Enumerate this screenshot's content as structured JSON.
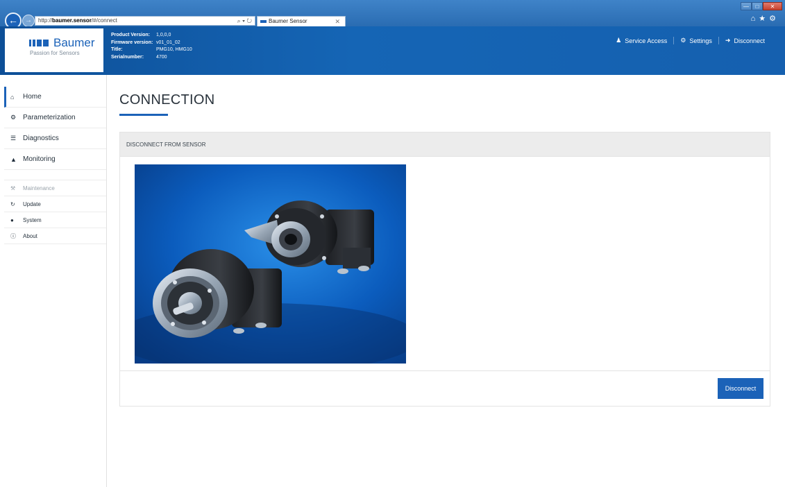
{
  "browser": {
    "url_prefix": "http://",
    "url_host": "baumer.sensor",
    "url_path": "/#/connect",
    "address_tools": "⌕ ▾ ↻",
    "tab_title": "Baumer Sensor",
    "tab_close": "✕",
    "window_min": "—",
    "window_max": "□",
    "window_close": "✕",
    "icons": [
      "home-icon",
      "star-icon",
      "gear-icon"
    ]
  },
  "header": {
    "brand": "Baumer",
    "tagline": "Passion for Sensors",
    "info": [
      {
        "key": "Product Version:",
        "value": "1,0,0,0"
      },
      {
        "key": "Firmware version:",
        "value": "v01_01_02"
      },
      {
        "key": "Title:",
        "value": "PMG10, HMG10"
      },
      {
        "key": "Serialnumber:",
        "value": "4700"
      }
    ],
    "menu": [
      {
        "label": "Service Access",
        "icon": "user-icon"
      },
      {
        "label": "Settings",
        "icon": "gear-icon"
      },
      {
        "label": "Disconnect",
        "icon": "sign-out-icon"
      }
    ]
  },
  "sidebar": {
    "items": [
      {
        "label": "Home",
        "icon": "home-icon",
        "active": true
      },
      {
        "label": "Parameterization",
        "icon": "cogs-icon"
      },
      {
        "label": "Diagnostics",
        "icon": "list-icon"
      },
      {
        "label": "Monitoring",
        "icon": "area-chart-icon"
      }
    ],
    "small_items": [
      {
        "label": "Maintenance",
        "icon": "wrench-icon",
        "muted": true
      },
      {
        "label": "Update",
        "icon": "refresh-icon"
      },
      {
        "label": "System",
        "icon": "system-icon"
      },
      {
        "label": "About",
        "icon": "info-icon"
      }
    ]
  },
  "main": {
    "title": "CONNECTION",
    "panel_title": "DISCONNECT FROM SENSOR",
    "disconnect_button": "Disconnect",
    "image_label": "▐ Baumer"
  },
  "colors": {
    "brand_blue": "#1b62b8",
    "header_blue": "#1565b5"
  }
}
